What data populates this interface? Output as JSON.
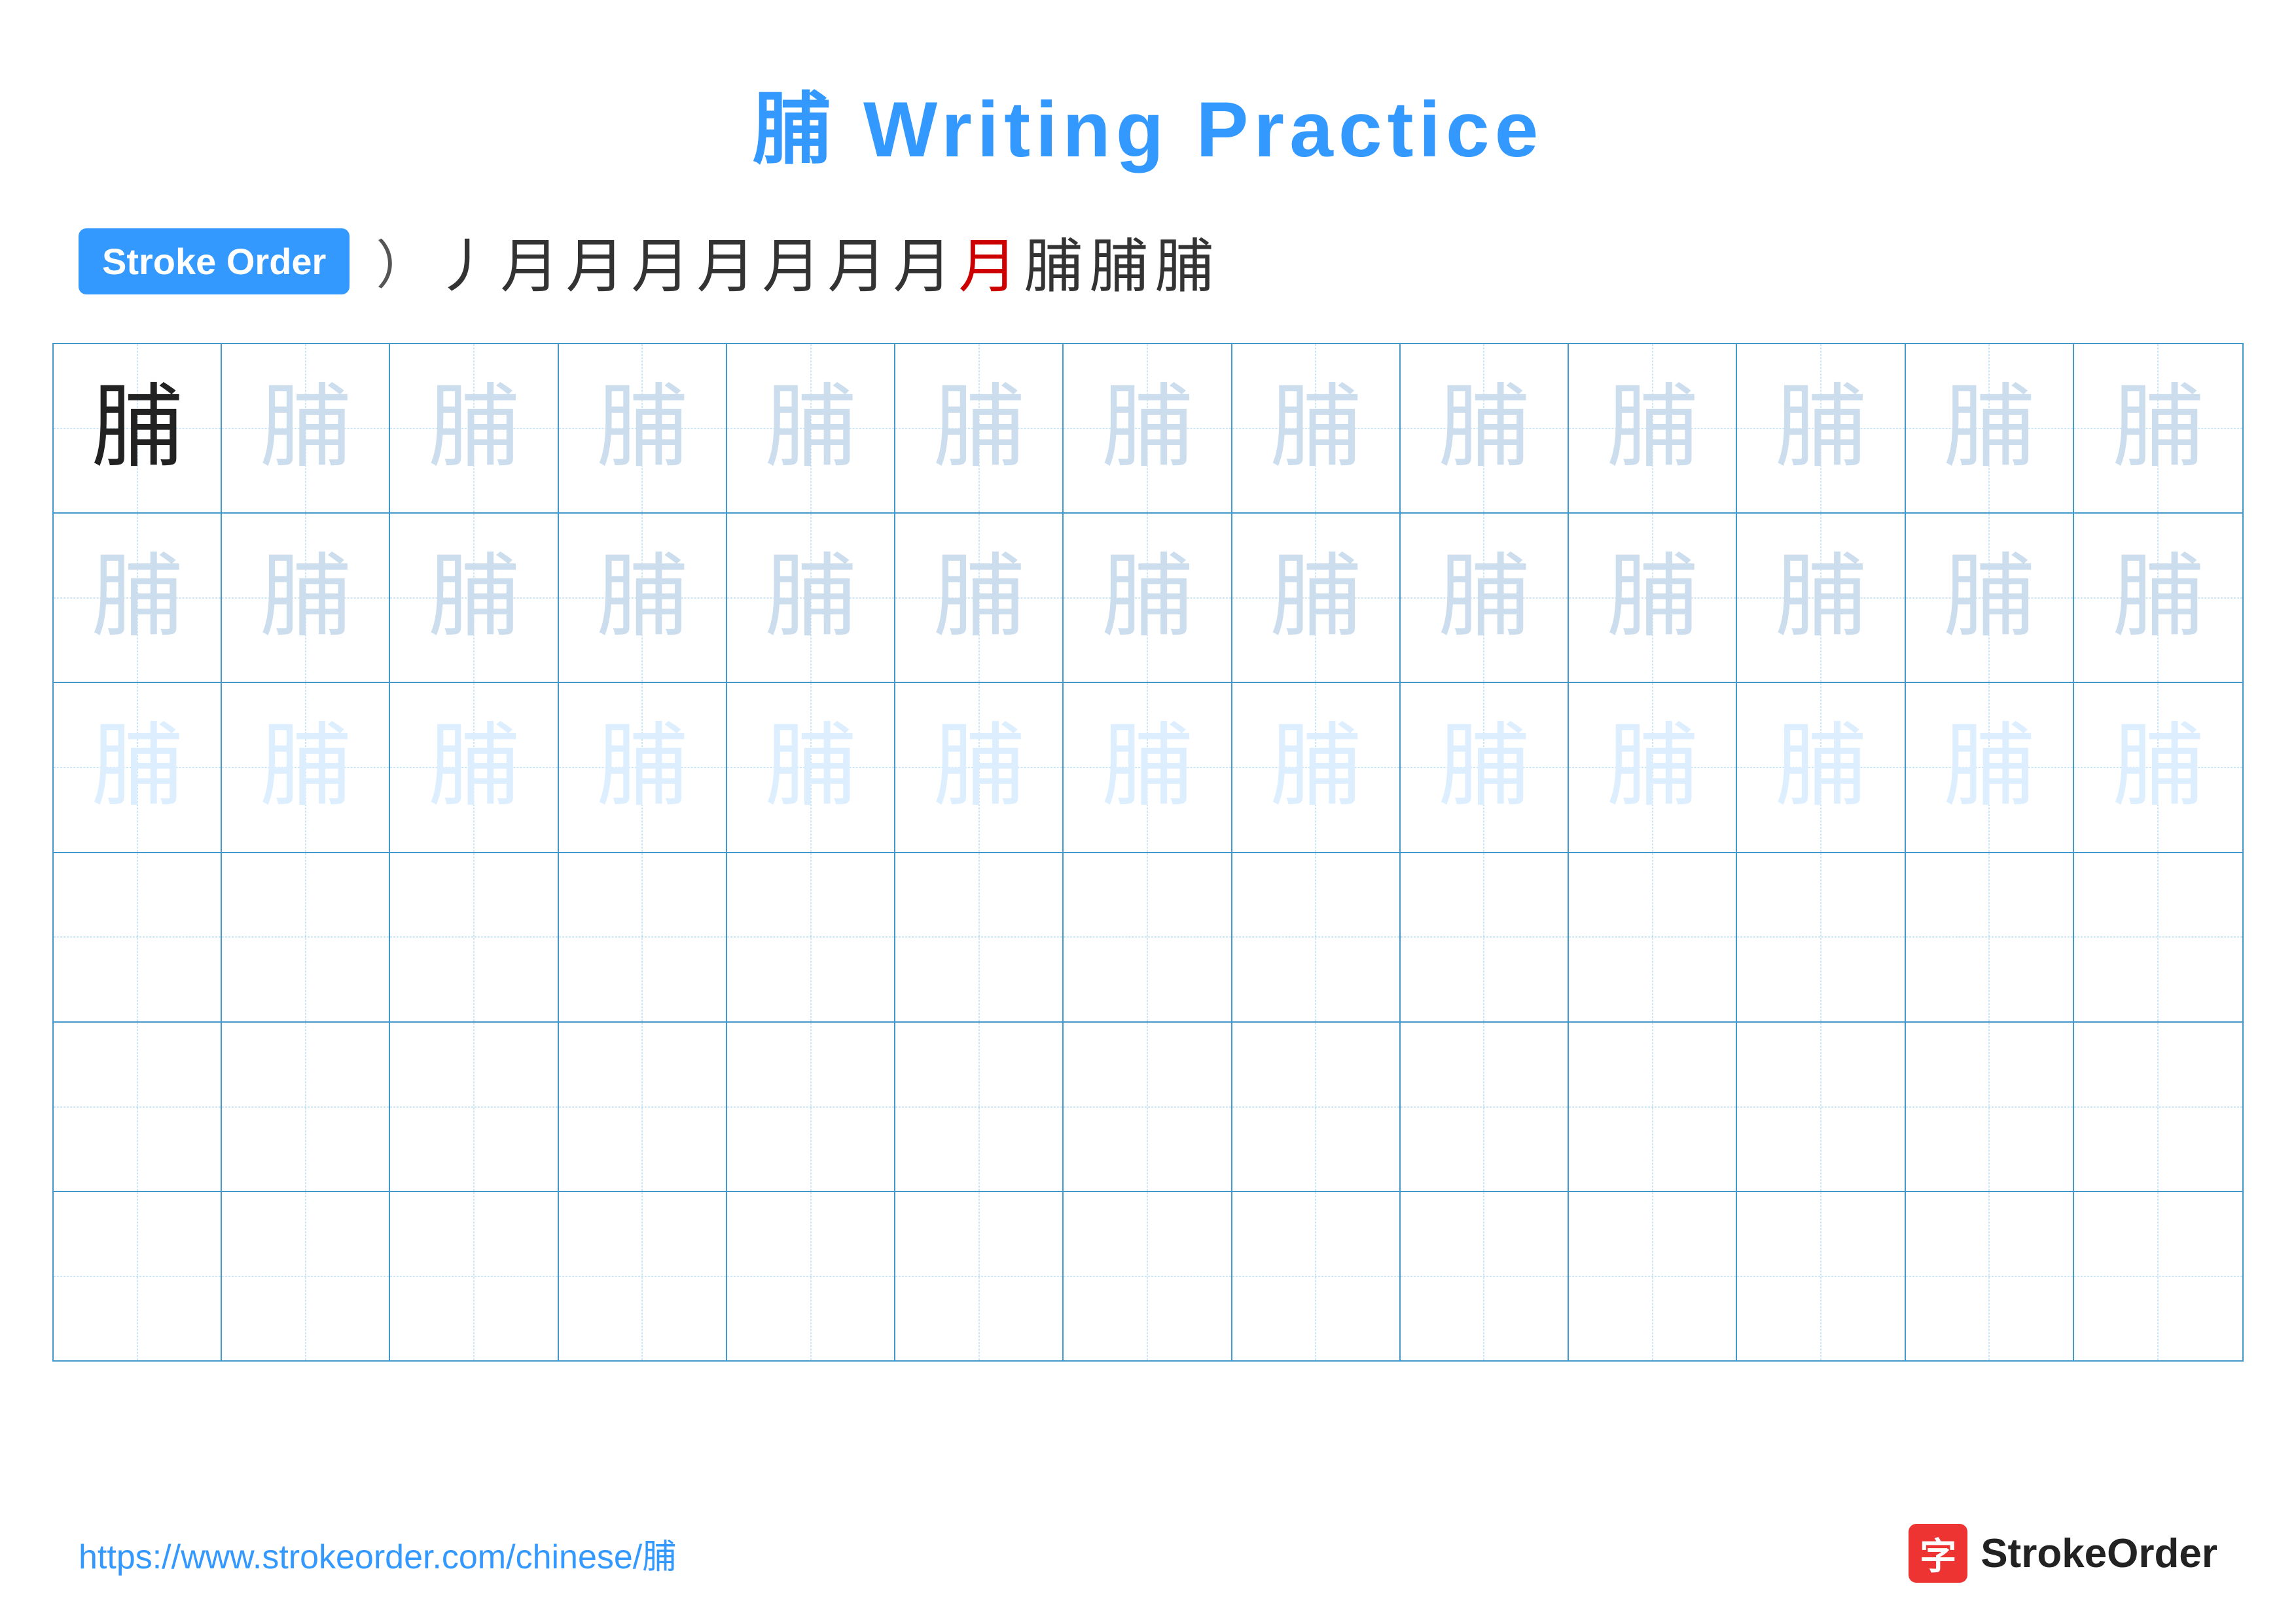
{
  "page": {
    "title": "脯 Writing Practice",
    "title_char": "脯",
    "title_text": "Writing Practice"
  },
  "stroke_order": {
    "badge_label": "Stroke Order",
    "paren": "）",
    "strokes": [
      "丿",
      "月",
      "月",
      "月",
      "月",
      "月",
      "月",
      "月",
      "月",
      "脯",
      "脯",
      "脯"
    ]
  },
  "practice_char": "脯",
  "grid": {
    "rows": 6,
    "cols": 13,
    "row1_first_dark": true,
    "char": "脯"
  },
  "footer": {
    "url": "https://www.strokeorder.com/chinese/脯",
    "logo_char": "字",
    "logo_text": "StrokeOrder"
  },
  "colors": {
    "accent": "#3399ff",
    "dark_char": "#222222",
    "light_char": "#ccddee",
    "grid_border": "#4499cc",
    "red": "#cc0000"
  }
}
